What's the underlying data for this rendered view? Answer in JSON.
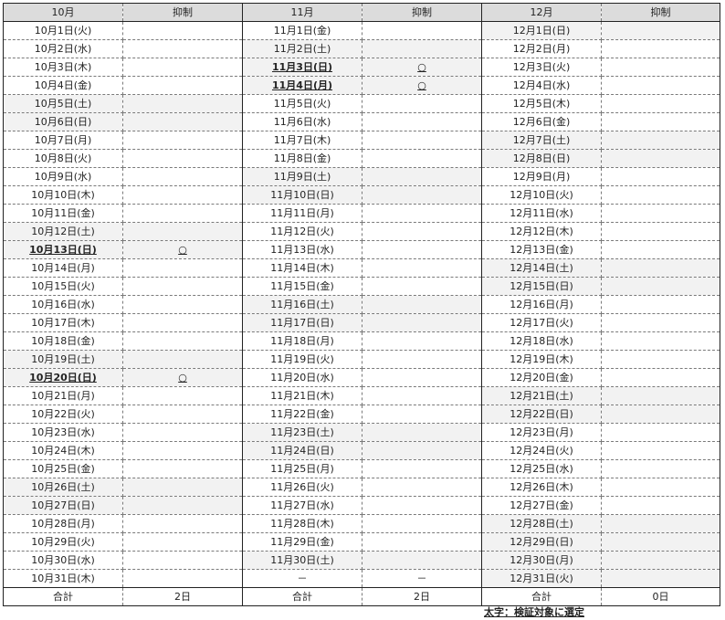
{
  "headers": [
    "10月",
    "抑制",
    "11月",
    "抑制",
    "12月",
    "抑制"
  ],
  "months": [
    {
      "days": [
        "10月1日(火)",
        "10月2日(水)",
        "10月3日(木)",
        "10月4日(金)",
        "10月5日(土)",
        "10月6日(日)",
        "10月7日(月)",
        "10月8日(火)",
        "10月9日(水)",
        "10月10日(木)",
        "10月11日(金)",
        "10月12日(土)",
        "10月13日(日)",
        "10月14日(月)",
        "10月15日(火)",
        "10月16日(水)",
        "10月17日(木)",
        "10月18日(金)",
        "10月19日(土)",
        "10月20日(日)",
        "10月21日(月)",
        "10月22日(火)",
        "10月23日(水)",
        "10月24日(木)",
        "10月25日(金)",
        "10月26日(土)",
        "10月27日(日)",
        "10月28日(月)",
        "10月29日(火)",
        "10月30日(水)",
        "10月31日(木)"
      ],
      "marks": [
        "",
        "",
        "",
        "",
        "",
        "",
        "",
        "",
        "",
        "",
        "",
        "",
        "○",
        "",
        "",
        "",
        "",
        "",
        "",
        "○",
        "",
        "",
        "",
        "",
        "",
        "",
        "",
        "",
        "",
        "",
        ""
      ],
      "bold": [
        12,
        19
      ],
      "shaded": [
        4,
        5,
        11,
        12,
        18,
        19,
        25,
        26
      ],
      "total_label": "合計",
      "total_value": "2日"
    },
    {
      "days": [
        "11月1日(金)",
        "11月2日(土)",
        "11月3日(日)",
        "11月4日(月)",
        "11月5日(火)",
        "11月6日(水)",
        "11月7日(木)",
        "11月8日(金)",
        "11月9日(土)",
        "11月10日(日)",
        "11月11日(月)",
        "11月12日(火)",
        "11月13日(水)",
        "11月14日(木)",
        "11月15日(金)",
        "11月16日(土)",
        "11月17日(日)",
        "11月18日(月)",
        "11月19日(火)",
        "11月20日(水)",
        "11月21日(木)",
        "11月22日(金)",
        "11月23日(土)",
        "11月24日(日)",
        "11月25日(月)",
        "11月26日(火)",
        "11月27日(水)",
        "11月28日(木)",
        "11月29日(金)",
        "11月30日(土)",
        "－"
      ],
      "marks": [
        "",
        "",
        "○",
        "○",
        "",
        "",
        "",
        "",
        "",
        "",
        "",
        "",
        "",
        "",
        "",
        "",
        "",
        "",
        "",
        "",
        "",
        "",
        "",
        "",
        "",
        "",
        "",
        "",
        "",
        "",
        "－"
      ],
      "bold": [
        2,
        3
      ],
      "shaded": [
        1,
        2,
        3,
        8,
        9,
        15,
        16,
        22,
        23,
        29
      ],
      "total_label": "合計",
      "total_value": "2日"
    },
    {
      "days": [
        "12月1日(日)",
        "12月2日(月)",
        "12月3日(火)",
        "12月4日(水)",
        "12月5日(木)",
        "12月6日(金)",
        "12月7日(土)",
        "12月8日(日)",
        "12月9日(月)",
        "12月10日(火)",
        "12月11日(水)",
        "12月12日(木)",
        "12月13日(金)",
        "12月14日(土)",
        "12月15日(日)",
        "12月16日(月)",
        "12月17日(火)",
        "12月18日(水)",
        "12月19日(木)",
        "12月20日(金)",
        "12月21日(土)",
        "12月22日(日)",
        "12月23日(月)",
        "12月24日(火)",
        "12月25日(水)",
        "12月26日(木)",
        "12月27日(金)",
        "12月28日(土)",
        "12月29日(日)",
        "12月30日(月)",
        "12月31日(火)"
      ],
      "marks": [
        "",
        "",
        "",
        "",
        "",
        "",
        "",
        "",
        "",
        "",
        "",
        "",
        "",
        "",
        "",
        "",
        "",
        "",
        "",
        "",
        "",
        "",
        "",
        "",
        "",
        "",
        "",
        "",
        "",
        "",
        ""
      ],
      "bold": [],
      "shaded": [
        0,
        6,
        7,
        13,
        14,
        20,
        21,
        27,
        28,
        29,
        30
      ],
      "total_label": "合計",
      "total_value": "0日"
    }
  ],
  "note": "太字：検証対象に選定"
}
